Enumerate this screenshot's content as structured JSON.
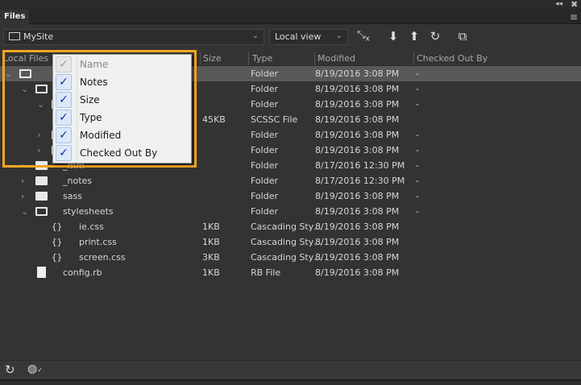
{
  "panel": {
    "tab": "Files",
    "collapse_icon": "double-chevron-icon",
    "close_icon": "close-icon",
    "menu_icon": "hamburger-icon"
  },
  "toolbar": {
    "site": "MySite",
    "view": "Local view",
    "buttons": [
      "disconnect-icon",
      "get-down-arrow-icon",
      "put-up-arrow-icon",
      "refresh-icon",
      "expand-icon"
    ]
  },
  "columns": {
    "local_files": "Local Files",
    "size": "Size",
    "type": "Type",
    "modified": "Modified",
    "checked_out_by": "Checked Out By"
  },
  "rows": [
    {
      "level": 0,
      "kind": "folder-open",
      "name": "",
      "size": "",
      "type": "Folder",
      "modified": "8/19/2016 3:08 PM",
      "checked": "-",
      "selected": true
    },
    {
      "level": 1,
      "kind": "folder-open",
      "name": "",
      "size": "",
      "type": "Folder",
      "modified": "8/19/2016 3:08 PM",
      "checked": "-"
    },
    {
      "level": 2,
      "kind": "folder-open",
      "name": "",
      "size": "",
      "type": "Folder",
      "modified": "8/19/2016 3:08 PM",
      "checked": "-"
    },
    {
      "level": 3,
      "kind": "file",
      "name": "",
      "size": "45KB",
      "type": "SCSSC File",
      "modified": "8/19/2016 3:08 PM",
      "checked": ""
    },
    {
      "level": 2,
      "kind": "folder",
      "name": "",
      "size": "",
      "type": "Folder",
      "modified": "8/19/2016 3:08 PM",
      "checked": "-"
    },
    {
      "level": 2,
      "kind": "folder",
      "name": "",
      "size": "",
      "type": "Folder",
      "modified": "8/19/2016 3:08 PM",
      "checked": "-"
    },
    {
      "level": 1,
      "kind": "folder",
      "name": "_mm",
      "size": "",
      "type": "Folder",
      "modified": "8/17/2016 12:30 PM",
      "checked": "-"
    },
    {
      "level": 1,
      "kind": "folder",
      "name": "_notes",
      "size": "",
      "type": "Folder",
      "modified": "8/17/2016 12:30 PM",
      "checked": "-"
    },
    {
      "level": 1,
      "kind": "folder",
      "name": "sass",
      "size": "",
      "type": "Folder",
      "modified": "8/19/2016 3:08 PM",
      "checked": "-"
    },
    {
      "level": 1,
      "kind": "folder-open",
      "name": "stylesheets",
      "size": "",
      "type": "Folder",
      "modified": "8/19/2016 3:08 PM",
      "checked": "-"
    },
    {
      "level": 2,
      "kind": "css",
      "name": "ie.css",
      "size": "1KB",
      "type": "Cascading Sty…",
      "modified": "8/19/2016 3:08 PM",
      "checked": ""
    },
    {
      "level": 2,
      "kind": "css",
      "name": "print.css",
      "size": "1KB",
      "type": "Cascading Sty…",
      "modified": "8/19/2016 3:08 PM",
      "checked": ""
    },
    {
      "level": 2,
      "kind": "css",
      "name": "screen.css",
      "size": "3KB",
      "type": "Cascading Sty…",
      "modified": "8/19/2016 3:08 PM",
      "checked": ""
    },
    {
      "level": 1,
      "kind": "file",
      "name": "config.rb",
      "size": "1KB",
      "type": "RB File",
      "modified": "8/19/2016 3:08 PM",
      "checked": ""
    }
  ],
  "column_menu": [
    {
      "label": "Name",
      "checked": true,
      "disabled": true
    },
    {
      "label": "Notes",
      "checked": true
    },
    {
      "label": "Size",
      "checked": true
    },
    {
      "label": "Type",
      "checked": true
    },
    {
      "label": "Modified",
      "checked": true
    },
    {
      "label": "Checked Out By",
      "checked": true
    }
  ],
  "highlight_color": "#f5a623",
  "bottom": {
    "icons": [
      "refresh-icon",
      "globe-check-icon"
    ]
  }
}
